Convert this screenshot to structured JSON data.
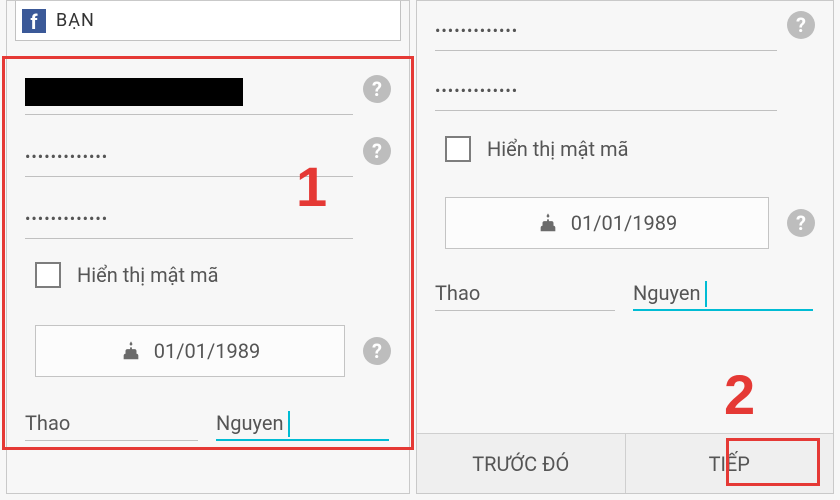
{
  "annotations": {
    "step1": "1",
    "step2": "2"
  },
  "left": {
    "header_label": "BẠN",
    "password_mask_1": "•••••••••••••",
    "password_mask_2": "•••••••••••••",
    "show_password_label": "Hiển thị mật mã",
    "date_value": "01/01/1989",
    "first_name": "Thao",
    "last_name": "Nguyen"
  },
  "right": {
    "password_mask_1": "•••••••••••••",
    "password_mask_2": "•••••••••••••",
    "show_password_label": "Hiển thị mật mã",
    "date_value": "01/01/1989",
    "first_name": "Thao",
    "last_name": "Nguyen",
    "back_label": "TRƯỚC ĐÓ",
    "next_label": "TIẾP"
  }
}
